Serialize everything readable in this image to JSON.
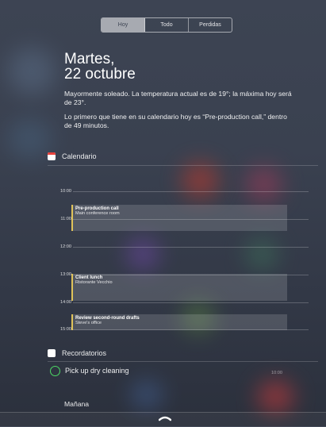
{
  "tabs": [
    {
      "label": "Hoy",
      "active": true
    },
    {
      "label": "Todo",
      "active": false
    },
    {
      "label": "Perdidas",
      "active": false
    }
  ],
  "today": {
    "day": "Martes,",
    "date": "22 octubre",
    "weather": "Mayormente soleado. La temperatura actual es de 19°; la máxima hoy será de 23°.",
    "next_event": "Lo primero que tiene en su calendario hoy es “Pre-production call,” dentro de 49 minutos."
  },
  "calendar": {
    "section_title": "Calendario",
    "hours": [
      "10:00",
      "11:00",
      "12:00",
      "13:00",
      "14:00",
      "15:00"
    ],
    "events": [
      {
        "title": "Pre-production call",
        "location": "Main conference room"
      },
      {
        "title": "Client lunch",
        "location": "Ristorante Vecchio"
      },
      {
        "title": "Review second-round drafts",
        "location": "Steve's office"
      }
    ]
  },
  "reminders": {
    "section_title": "Recordatorios",
    "items": [
      {
        "text": "Pick up dry cleaning",
        "time": "10:00"
      }
    ]
  },
  "tomorrow": {
    "label": "Mañana"
  },
  "colors": {
    "accent_event": "#e0c35a",
    "reminder_circle": "#4cd964",
    "calendar_icon": "#e8413b"
  }
}
